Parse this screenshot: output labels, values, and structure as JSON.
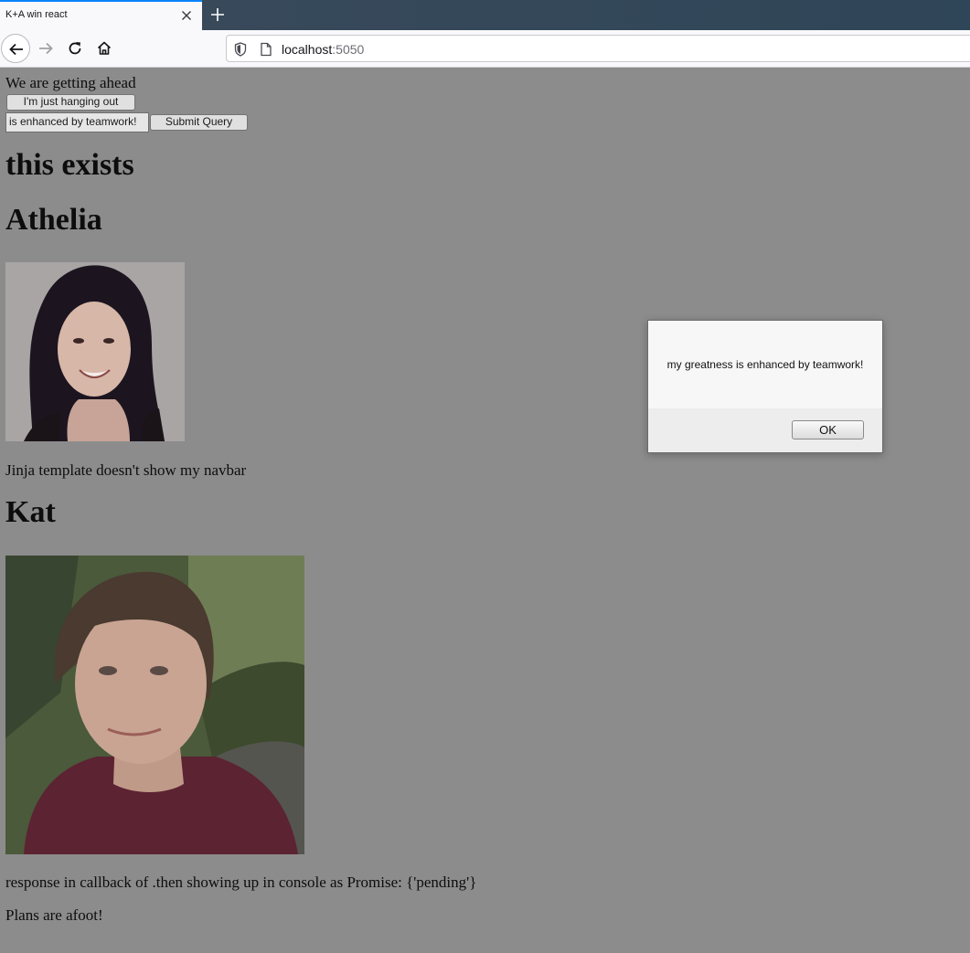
{
  "browser": {
    "tab_title": "K+A win react",
    "url_host": "localhost",
    "url_port": ":5050"
  },
  "page": {
    "intro_text": "We are getting ahead",
    "hang_button": "I'm just hanging out",
    "text_input_value": "is enhanced by teamwork!",
    "submit_button": "Submit Query",
    "heading_main": "this exists",
    "sections": [
      {
        "name": "Athelia",
        "caption": "Jinja template doesn't show my navbar"
      },
      {
        "name": "Kat",
        "caption": "response in callback of .then showing up in console as Promise: {'pending'}"
      }
    ],
    "footer_text": "Plans are afoot!"
  },
  "alert": {
    "message": "my greatness is enhanced by teamwork!",
    "ok_label": "OK"
  }
}
